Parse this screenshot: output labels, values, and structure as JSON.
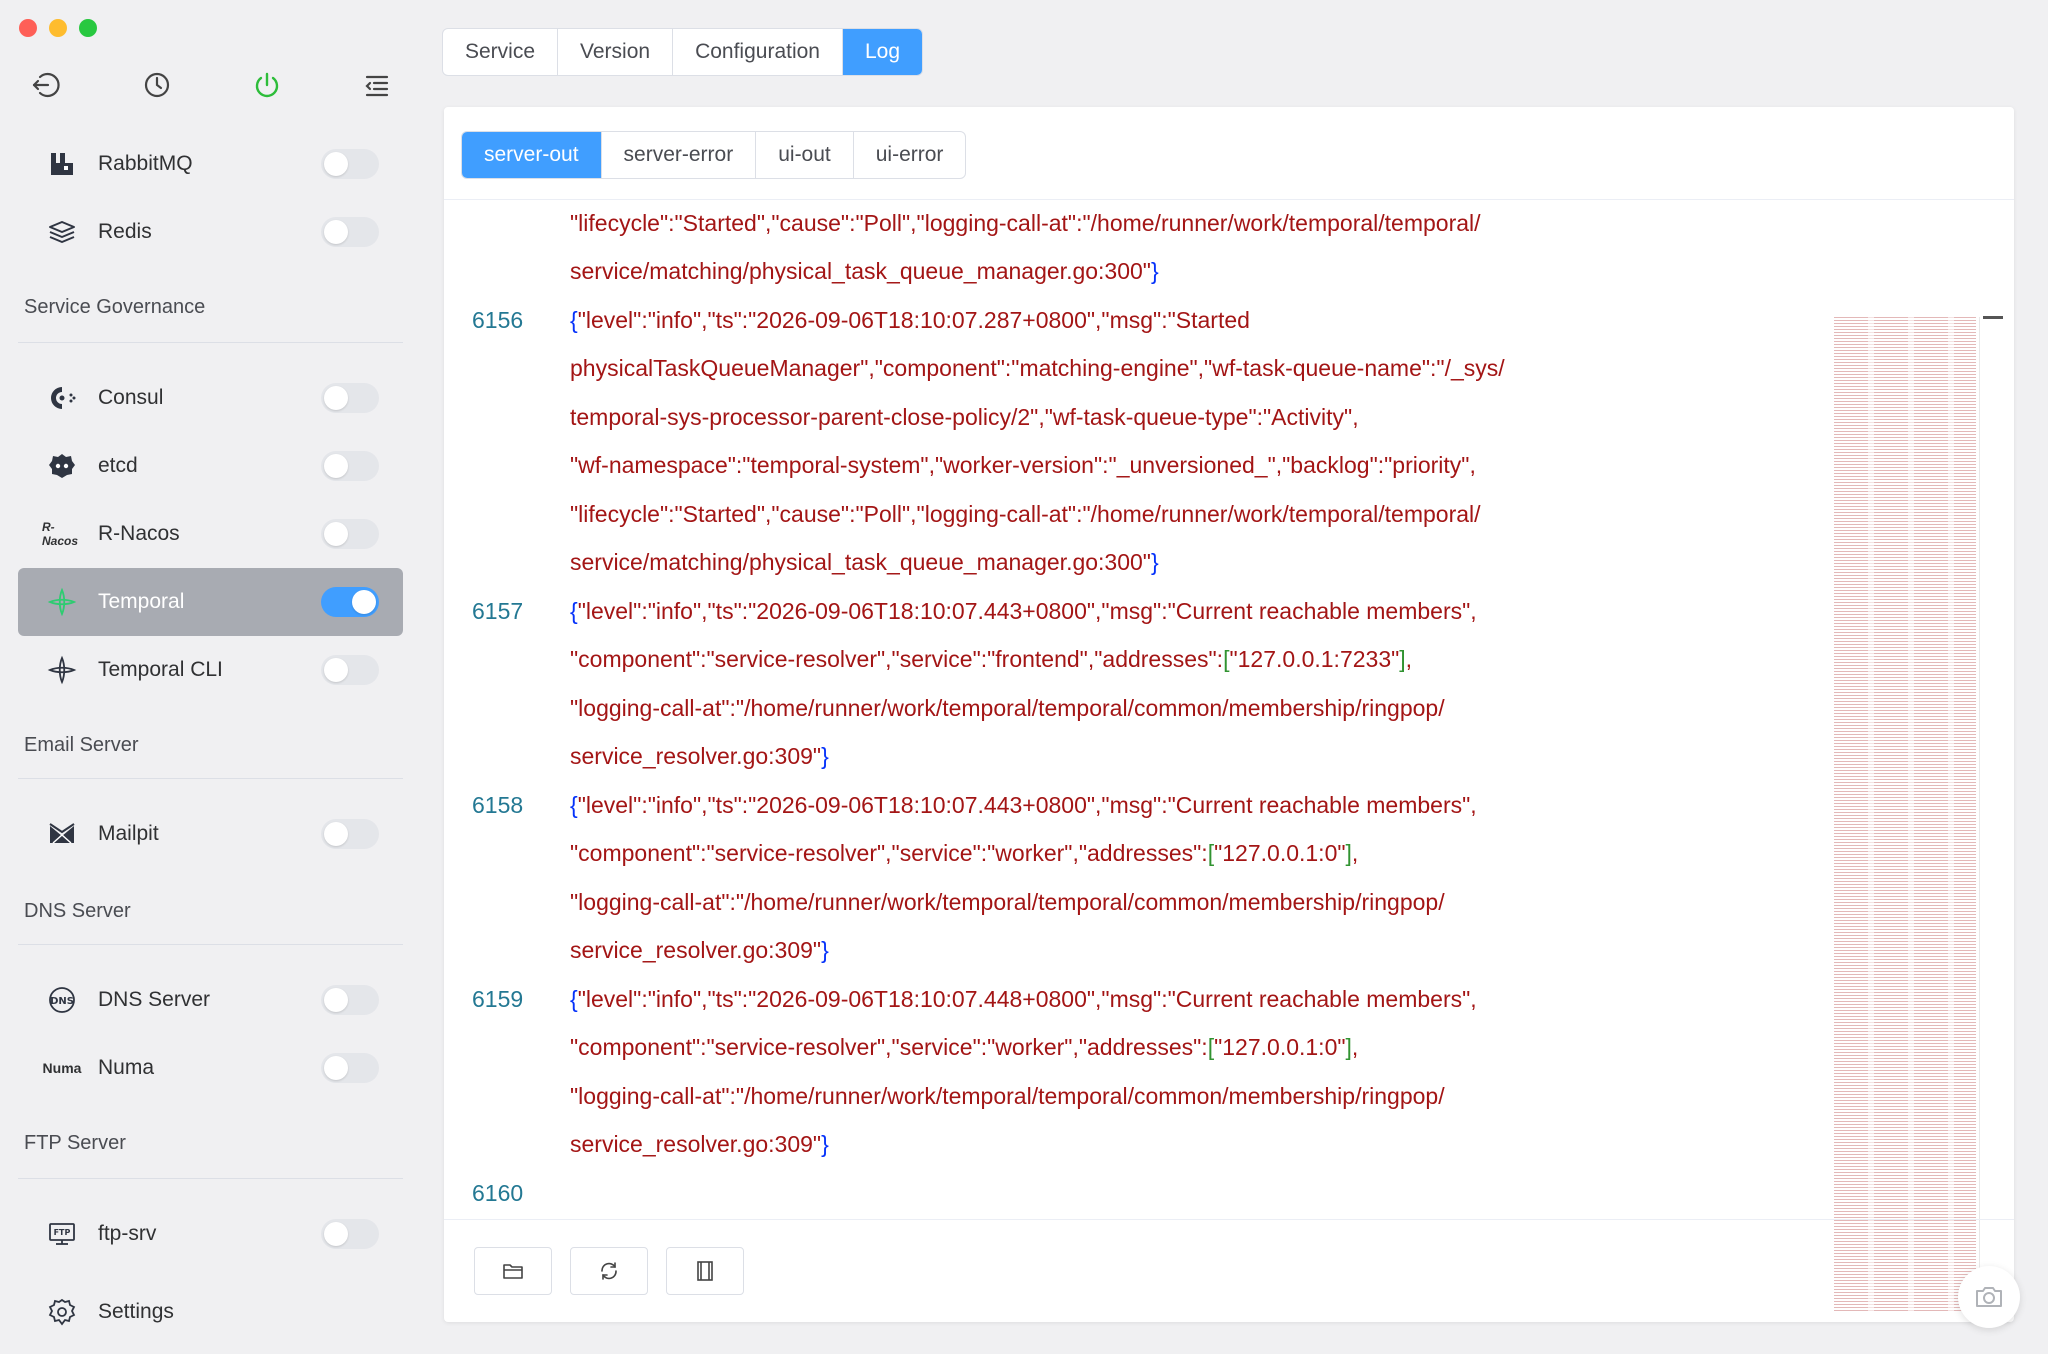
{
  "toolbar": {
    "icons": [
      "back-icon",
      "history-icon",
      "power-icon",
      "menu-collapse-icon"
    ],
    "power_color": "#2dbd3a"
  },
  "sidebar": {
    "items_top": [
      {
        "label": "RabbitMQ",
        "icon": "rabbitmq-icon",
        "enabled": false
      },
      {
        "label": "Redis",
        "icon": "redis-icon",
        "enabled": false
      }
    ],
    "groups": [
      {
        "title": "Service Governance",
        "items": [
          {
            "label": "Consul",
            "icon": "consul-icon",
            "enabled": false
          },
          {
            "label": "etcd",
            "icon": "etcd-icon",
            "enabled": false
          },
          {
            "label": "R-Nacos",
            "icon": "r-nacos-icon",
            "icon_text": "R-Nacos",
            "enabled": false
          },
          {
            "label": "Temporal",
            "icon": "temporal-icon",
            "enabled": true,
            "active": true
          },
          {
            "label": "Temporal CLI",
            "icon": "temporal-cli-icon",
            "enabled": false
          }
        ]
      },
      {
        "title": "Email Server",
        "items": [
          {
            "label": "Mailpit",
            "icon": "mailpit-icon",
            "enabled": false
          }
        ]
      },
      {
        "title": "DNS Server",
        "items": [
          {
            "label": "DNS Server",
            "icon": "dns-icon",
            "enabled": false
          },
          {
            "label": "Numa",
            "icon": "numa-icon",
            "icon_text": "Numa",
            "enabled": false
          }
        ]
      },
      {
        "title": "FTP Server",
        "items": [
          {
            "label": "ftp-srv",
            "icon": "ftp-icon",
            "enabled": false
          }
        ]
      }
    ],
    "settings_label": "Settings"
  },
  "tabs": {
    "items": [
      "Service",
      "Version",
      "Configuration",
      "Log"
    ],
    "active": "Log"
  },
  "log_tabs": {
    "items": [
      "server-out",
      "server-error",
      "ui-out",
      "ui-error"
    ],
    "active": "server-out"
  },
  "log": {
    "lines": [
      {
        "num": "",
        "text": "\"lifecycle\":\"Started\",\"cause\":\"Poll\",\"logging-call-at\":\"/home/runner/work/temporal/temporal/"
      },
      {
        "num": "",
        "text": "service/matching/physical_task_queue_manager.go:300\"}"
      },
      {
        "num": "6156",
        "text": "{\"level\":\"info\",\"ts\":\"2026-09-06T18:10:07.287+0800\",\"msg\":\"Started"
      },
      {
        "num": "",
        "text": "physicalTaskQueueManager\",\"component\":\"matching-engine\",\"wf-task-queue-name\":\"/_sys/"
      },
      {
        "num": "",
        "text": "temporal-sys-processor-parent-close-policy/2\",\"wf-task-queue-type\":\"Activity\","
      },
      {
        "num": "",
        "text": "\"wf-namespace\":\"temporal-system\",\"worker-version\":\"_unversioned_\",\"backlog\":\"priority\","
      },
      {
        "num": "",
        "text": "\"lifecycle\":\"Started\",\"cause\":\"Poll\",\"logging-call-at\":\"/home/runner/work/temporal/temporal/"
      },
      {
        "num": "",
        "text": "service/matching/physical_task_queue_manager.go:300\"}"
      },
      {
        "num": "6157",
        "text": "{\"level\":\"info\",\"ts\":\"2026-09-06T18:10:07.443+0800\",\"msg\":\"Current reachable members\","
      },
      {
        "num": "",
        "text": "\"component\":\"service-resolver\",\"service\":\"frontend\",\"addresses\":[\"127.0.0.1:7233\"],"
      },
      {
        "num": "",
        "text": "\"logging-call-at\":\"/home/runner/work/temporal/temporal/common/membership/ringpop/"
      },
      {
        "num": "",
        "text": "service_resolver.go:309\"}"
      },
      {
        "num": "6158",
        "text": "{\"level\":\"info\",\"ts\":\"2026-09-06T18:10:07.443+0800\",\"msg\":\"Current reachable members\","
      },
      {
        "num": "",
        "text": "\"component\":\"service-resolver\",\"service\":\"worker\",\"addresses\":[\"127.0.0.1:0\"],"
      },
      {
        "num": "",
        "text": "\"logging-call-at\":\"/home/runner/work/temporal/temporal/common/membership/ringpop/"
      },
      {
        "num": "",
        "text": "service_resolver.go:309\"}"
      },
      {
        "num": "6159",
        "text": "{\"level\":\"info\",\"ts\":\"2026-09-06T18:10:07.448+0800\",\"msg\":\"Current reachable members\","
      },
      {
        "num": "",
        "text": "\"component\":\"service-resolver\",\"service\":\"worker\",\"addresses\":[\"127.0.0.1:0\"],"
      },
      {
        "num": "",
        "text": "\"logging-call-at\":\"/home/runner/work/temporal/temporal/common/membership/ringpop/"
      },
      {
        "num": "",
        "text": "service_resolver.go:309\"}"
      },
      {
        "num": "6160",
        "text": ""
      }
    ]
  },
  "footer": {
    "buttons": [
      "open-folder-icon",
      "refresh-icon",
      "wrap-panel-icon"
    ]
  },
  "fab": {
    "icon": "camera-icon"
  },
  "colors": {
    "accent": "#409eff",
    "string": "#a31515",
    "bracket_curly": "#0431fa",
    "bracket_square": "#319331",
    "line_number": "#237893"
  }
}
